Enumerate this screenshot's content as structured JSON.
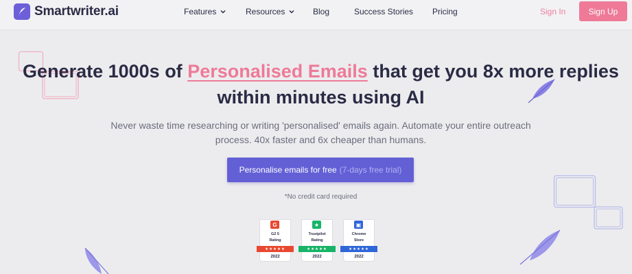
{
  "brand": {
    "name": "Smartwriter.ai",
    "accent": "#6c5fd8",
    "pink": "#ee7a98"
  },
  "nav": {
    "items": [
      {
        "label": "Features",
        "has_dropdown": true
      },
      {
        "label": "Resources",
        "has_dropdown": true
      },
      {
        "label": "Blog",
        "has_dropdown": false
      },
      {
        "label": "Success Stories",
        "has_dropdown": false
      },
      {
        "label": "Pricing",
        "has_dropdown": false
      }
    ],
    "sign_in": "Sign In",
    "sign_up": "Sign Up"
  },
  "hero": {
    "headline_before": "Generate 1000s of",
    "headline_highlight": "Personalised Emails",
    "headline_after": "that get you 8x more replies within minutes using AI",
    "subtitle": "Never waste time researching or writing 'personalised' emails again. Automate your entire outreach process. 40x faster and 6x cheaper than humans.",
    "cta_main": "Personalise emails for free",
    "cta_muted": "(7-days free trial)",
    "note": "*No credit card required"
  },
  "badges": [
    {
      "title_line1": "G2 5",
      "title_line2": "Rating",
      "stars": "★★★★★",
      "year": "2022",
      "color": "#e8482f",
      "icon": "g2-icon",
      "glyph": "G"
    },
    {
      "title_line1": "Trustpilot",
      "title_line2": "Rating",
      "stars": "★★★★★",
      "year": "2022",
      "color": "#17b467",
      "icon": "trustpilot-star-icon",
      "glyph": "★"
    },
    {
      "title_line1": "Chrome",
      "title_line2": "Store",
      "stars": "★★★★★",
      "year": "2022",
      "color": "#2f66d8",
      "icon": "chrome-store-icon",
      "glyph": "▣"
    }
  ]
}
